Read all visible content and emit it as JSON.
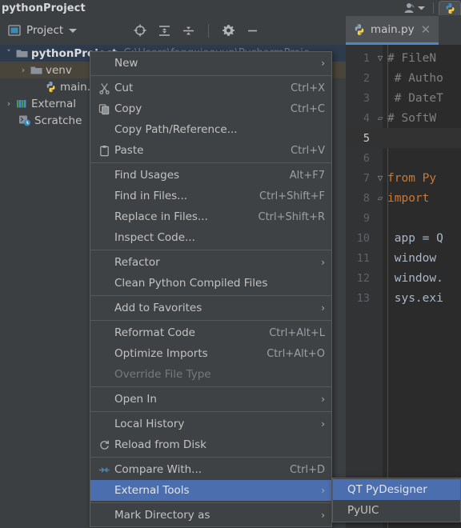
{
  "titlebar": {
    "project_name": "pythonProject",
    "account_icon": "user-account-icon",
    "account_caret": "chevron-down-icon",
    "python_icon": "python-file-icon"
  },
  "toolbar": {
    "project_panel_label": "Project",
    "project_panel_icon": "project-panel-icon",
    "dropdown_icon": "chevron-down-icon",
    "icons": [
      {
        "name": "locate-target-icon",
        "title": "Select Opened File"
      },
      {
        "name": "expand-all-icon",
        "title": "Expand All"
      },
      {
        "name": "collapse-all-icon",
        "title": "Collapse All"
      },
      {
        "name": "settings-gear-icon",
        "title": "Settings"
      },
      {
        "name": "hide-panel-icon",
        "title": "Hide"
      }
    ]
  },
  "editor_tab": {
    "label": "main.py",
    "file_icon": "python-file-icon",
    "close_icon": "close-icon"
  },
  "project_tree": [
    {
      "label": "pythonProject",
      "path": "C:\\Users\\fangxiaoyun\\PycharmProje",
      "icon": "folder-icon",
      "arrow": "chevron-expanded-icon",
      "indent": 0,
      "bold": true,
      "state": "selected"
    },
    {
      "label": "venv",
      "path": "",
      "icon": "folder-icon",
      "arrow": "chevron-collapsed-icon",
      "indent": 1,
      "bold": false,
      "state": "hovered"
    },
    {
      "label": "main.",
      "path": "",
      "icon": "python-file-icon",
      "arrow": "",
      "indent": 2,
      "bold": false,
      "state": "normal"
    },
    {
      "label": "External",
      "path": "",
      "icon": "external-libraries-icon",
      "arrow": "chevron-collapsed-icon",
      "indent": 0,
      "bold": false,
      "state": "normal"
    },
    {
      "label": "Scratche",
      "path": "",
      "icon": "scratches-icon",
      "arrow": "",
      "indent": 1,
      "bold": false,
      "state": "normal"
    }
  ],
  "editor": {
    "lines": [
      {
        "n": "1",
        "fold": "minus-square",
        "segments": [
          {
            "t": "# FileN",
            "cls": "c-comment"
          }
        ],
        "current": false
      },
      {
        "n": "2",
        "fold": "",
        "segments": [
          {
            "t": " # Autho",
            "cls": "c-comment"
          }
        ],
        "current": false
      },
      {
        "n": "3",
        "fold": "",
        "segments": [
          {
            "t": " # DateT",
            "cls": "c-comment"
          }
        ],
        "current": false
      },
      {
        "n": "4",
        "fold": "end-fold",
        "segments": [
          {
            "t": "# SoftW",
            "cls": "c-comment"
          }
        ],
        "current": false
      },
      {
        "n": "5",
        "fold": "",
        "segments": [
          {
            "t": "",
            "cls": "c-plain"
          }
        ],
        "current": true
      },
      {
        "n": "6",
        "fold": "",
        "segments": [
          {
            "t": "",
            "cls": "c-plain"
          }
        ],
        "current": false
      },
      {
        "n": "7",
        "fold": "minus-square",
        "segments": [
          {
            "t": "from Py",
            "cls": "c-kw"
          }
        ],
        "current": false
      },
      {
        "n": "8",
        "fold": "end-fold",
        "segments": [
          {
            "t": "import ",
            "cls": "c-kw"
          }
        ],
        "current": false
      },
      {
        "n": "9",
        "fold": "",
        "segments": [
          {
            "t": "",
            "cls": "c-plain"
          }
        ],
        "current": false
      },
      {
        "n": "10",
        "fold": "",
        "segments": [
          {
            "t": " app = Q",
            "cls": "c-plain"
          }
        ],
        "current": false
      },
      {
        "n": "11",
        "fold": "",
        "segments": [
          {
            "t": " window ",
            "cls": "c-plain"
          }
        ],
        "current": false
      },
      {
        "n": "12",
        "fold": "",
        "segments": [
          {
            "t": " window.",
            "cls": "c-plain"
          }
        ],
        "current": false
      },
      {
        "n": "13",
        "fold": "",
        "segments": [
          {
            "t": " sys.exi",
            "cls": "c-plain"
          }
        ],
        "current": false
      }
    ]
  },
  "context_menu": {
    "items": [
      {
        "type": "item",
        "label": "New",
        "shortcut": "",
        "icon": "",
        "submenu": true,
        "selected": false,
        "disabled": false
      },
      {
        "type": "separator"
      },
      {
        "type": "item",
        "label": "Cut",
        "shortcut": "Ctrl+X",
        "icon": "cut-icon",
        "submenu": false,
        "selected": false,
        "disabled": false
      },
      {
        "type": "item",
        "label": "Copy",
        "shortcut": "Ctrl+C",
        "icon": "copy-icon",
        "submenu": false,
        "selected": false,
        "disabled": false,
        "mnemonic": "C"
      },
      {
        "type": "item",
        "label": "Copy Path/Reference...",
        "shortcut": "",
        "icon": "",
        "submenu": false,
        "selected": false,
        "disabled": false
      },
      {
        "type": "item",
        "label": "Paste",
        "shortcut": "Ctrl+V",
        "icon": "paste-icon",
        "submenu": false,
        "selected": false,
        "disabled": false,
        "mnemonic": "P"
      },
      {
        "type": "separator"
      },
      {
        "type": "item",
        "label": "Find Usages",
        "shortcut": "Alt+F7",
        "icon": "",
        "submenu": false,
        "selected": false,
        "disabled": false,
        "mnemonic": "U"
      },
      {
        "type": "item",
        "label": "Find in Files...",
        "shortcut": "Ctrl+Shift+F",
        "icon": "",
        "submenu": false,
        "selected": false,
        "disabled": false
      },
      {
        "type": "item",
        "label": "Replace in Files...",
        "shortcut": "Ctrl+Shift+R",
        "icon": "",
        "submenu": false,
        "selected": false,
        "disabled": false,
        "mnemonic": "a"
      },
      {
        "type": "item",
        "label": "Inspect Code...",
        "shortcut": "",
        "icon": "",
        "submenu": false,
        "selected": false,
        "disabled": false,
        "mnemonic": "I"
      },
      {
        "type": "separator"
      },
      {
        "type": "item",
        "label": "Refactor",
        "shortcut": "",
        "icon": "",
        "submenu": true,
        "selected": false,
        "disabled": false,
        "mnemonic": "R"
      },
      {
        "type": "item",
        "label": "Clean Python Compiled Files",
        "shortcut": "",
        "icon": "",
        "submenu": false,
        "selected": false,
        "disabled": false
      },
      {
        "type": "separator"
      },
      {
        "type": "item",
        "label": "Add to Favorites",
        "shortcut": "",
        "icon": "",
        "submenu": true,
        "selected": false,
        "disabled": false,
        "mnemonic": "F"
      },
      {
        "type": "separator"
      },
      {
        "type": "item",
        "label": "Reformat Code",
        "shortcut": "Ctrl+Alt+L",
        "icon": "",
        "submenu": false,
        "selected": false,
        "disabled": false,
        "mnemonic": "R"
      },
      {
        "type": "item",
        "label": "Optimize Imports",
        "shortcut": "Ctrl+Alt+O",
        "icon": "",
        "submenu": false,
        "selected": false,
        "disabled": false,
        "mnemonic": "z"
      },
      {
        "type": "item",
        "label": "Override File Type",
        "shortcut": "",
        "icon": "",
        "submenu": false,
        "selected": false,
        "disabled": true
      },
      {
        "type": "separator"
      },
      {
        "type": "item",
        "label": "Open In",
        "shortcut": "",
        "icon": "",
        "submenu": true,
        "selected": false,
        "disabled": false
      },
      {
        "type": "separator"
      },
      {
        "type": "item",
        "label": "Local History",
        "shortcut": "",
        "icon": "",
        "submenu": true,
        "selected": false,
        "disabled": false,
        "mnemonic": "H"
      },
      {
        "type": "item",
        "label": "Reload from Disk",
        "shortcut": "",
        "icon": "reload-icon",
        "submenu": false,
        "selected": false,
        "disabled": false
      },
      {
        "type": "separator"
      },
      {
        "type": "item",
        "label": "Compare With...",
        "shortcut": "Ctrl+D",
        "icon": "compare-icon",
        "submenu": false,
        "selected": false,
        "disabled": false
      },
      {
        "type": "item",
        "label": "External Tools",
        "shortcut": "",
        "icon": "",
        "submenu": true,
        "selected": true,
        "disabled": false
      },
      {
        "type": "separator"
      },
      {
        "type": "item",
        "label": "Mark Directory as",
        "shortcut": "",
        "icon": "",
        "submenu": true,
        "selected": false,
        "disabled": false
      }
    ]
  },
  "submenu": {
    "items": [
      {
        "label": "QT PyDesigner",
        "selected": true
      },
      {
        "label": "PyUIC",
        "selected": false
      }
    ]
  },
  "colors": {
    "background": "#3c3f41",
    "menu_background": "#3f4244",
    "selection_blue": "#4b6eaf",
    "tab_accent": "#4a88c7",
    "editor_background": "#2b2b2b",
    "tree_selected": "#2d3b4d",
    "tree_hovered": "#4a453a",
    "comment_gray": "#808080",
    "keyword_orange": "#cc7832",
    "code_text": "#a9b7c6",
    "path_text": "#6b7a8c"
  }
}
